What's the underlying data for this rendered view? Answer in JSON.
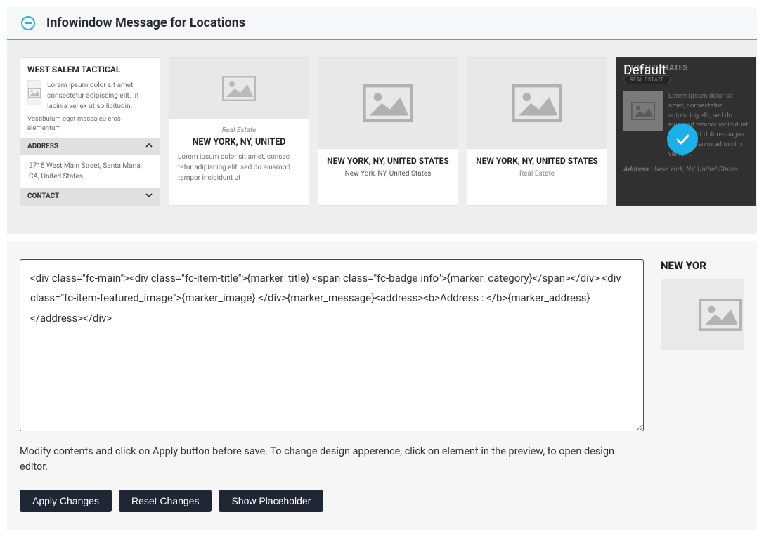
{
  "section": {
    "title": "Infowindow Message for Locations"
  },
  "templates": [
    {
      "kind": "accordion",
      "title": "WEST SALEM TACTICAL",
      "desc_side": "Lorem ipsum dolor sit amet, consectetur adipiscing elit. In lacinia vel ex ut sollicitudin.",
      "desc_full": "Vestibulum eget massa eu eros elementum",
      "acc_address_label": "ADDRESS",
      "address": "2715 West Main Street, Santa Maria, CA, United States",
      "acc_contact_label": "CONTACT"
    },
    {
      "kind": "image-sub-title-desc",
      "subcat": "Real Estate",
      "title": "NEW YORK, NY, UNITED",
      "desc": "Lorem ipsum dolor sit amet, consec tetur adipiscing elit, sed do eiusmod tempor incididunt ut"
    },
    {
      "kind": "image-title-sub",
      "title": "NEW YORK, NY, UNITED STATES",
      "subtitle": "New York, NY, United States"
    },
    {
      "kind": "image-title-cat",
      "title": "NEW YORK, NY, UNITED STATES",
      "subcat": "Real Estate"
    },
    {
      "kind": "dark-selected",
      "selected_label": "Default",
      "title": "Y, UNITED STATES",
      "badge": "REAL ESTATE",
      "desc": "Lorem ipsum dolor sit amet, consectetur adipiscing elit, sed do eiusmod tempor incididunt ut labore et dolore magna aliqua. Ut enim ad minim veniam.",
      "addr_label": "Address :",
      "addr_value": "New York, NY, United States"
    }
  ],
  "editor": {
    "textarea_value": "<div class=\"fc-main\"><div class=\"fc-item-title\">{marker_title} <span class=\"fc-badge info\">{marker_category}</span></div> <div class=\"fc-item-featured_image\">{marker_image} </div>{marker_message}<address><b>Address : </b>{marker_address}</address></div>",
    "help_text": "Modify contents and click on Apply button before save. To change design apperence, click on element in the preview, to open design editor.",
    "btn_apply": "Apply Changes",
    "btn_reset": "Reset Changes",
    "btn_placeholder": "Show Placeholder"
  },
  "preview": {
    "title": "NEW YOR"
  }
}
